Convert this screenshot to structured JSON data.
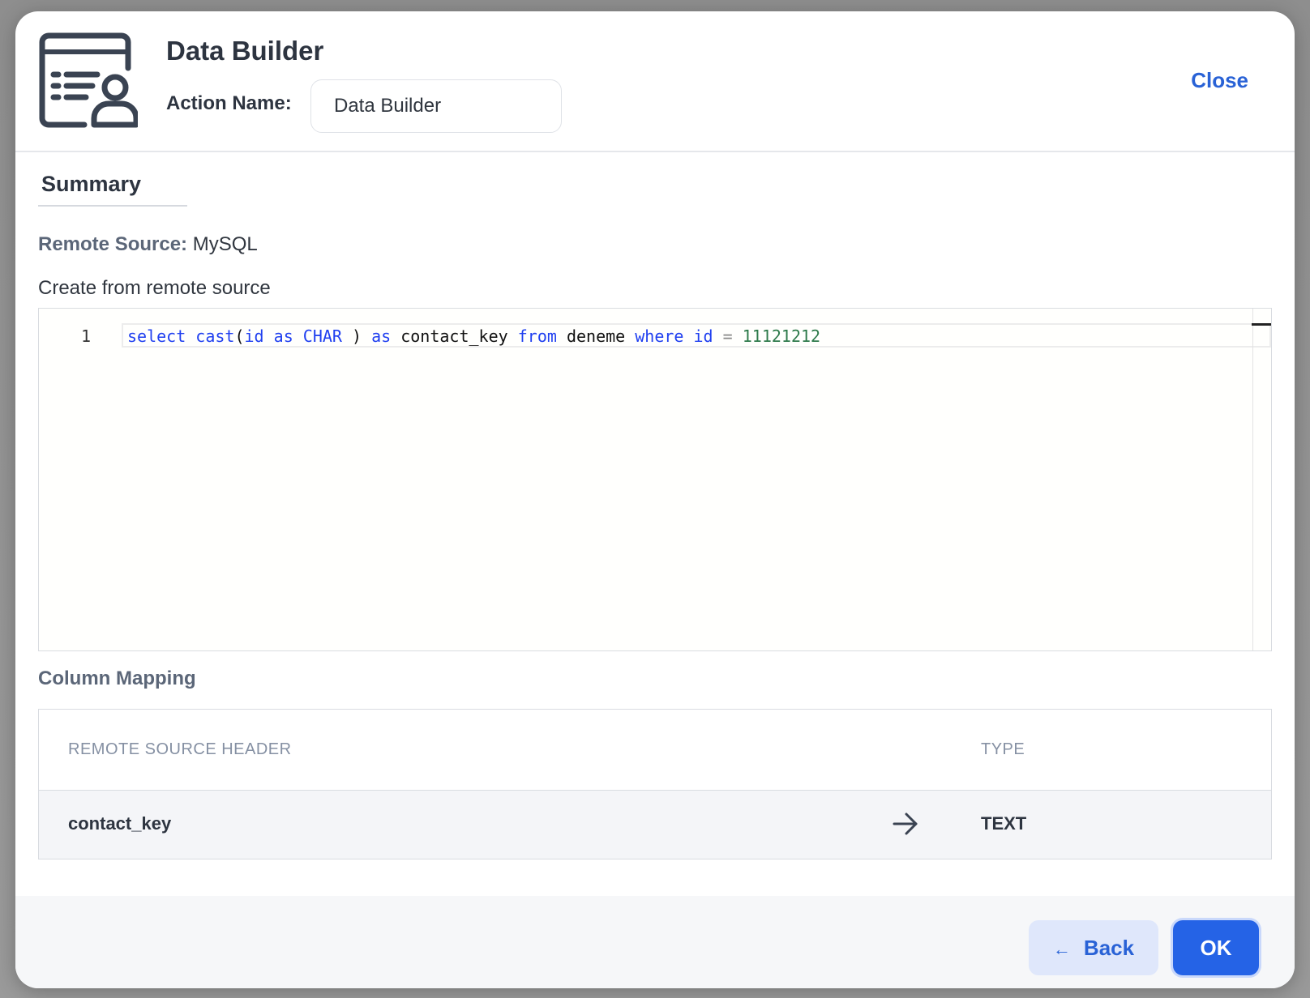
{
  "header": {
    "title": "Data Builder",
    "action_name_label": "Action Name:",
    "action_name_value": "Data Builder",
    "close_label": "Close",
    "icon": "data-builder-icon"
  },
  "summary": {
    "tab_label": "Summary",
    "remote_source_label": "Remote Source:",
    "remote_source_value": "MySQL",
    "create_label": "Create from remote source"
  },
  "editor": {
    "line_number": "1",
    "tokens": {
      "t1": "select",
      "t2": "cast",
      "t3": "(",
      "t4": "id",
      "t5": "as",
      "t6": "CHAR",
      "t7": " ) ",
      "t8": "as",
      "t9": " contact_key ",
      "t10": "from",
      "t11": " deneme ",
      "t12": "where",
      "t13": "id",
      "t14": "=",
      "t15": "11121212"
    }
  },
  "column_mapping": {
    "title": "Column Mapping",
    "headers": {
      "source": "REMOTE SOURCE HEADER",
      "type": "TYPE"
    },
    "rows": [
      {
        "source": "contact_key",
        "type": "TEXT"
      }
    ]
  },
  "footer": {
    "back_label": "Back",
    "back_arrow": "←",
    "ok_label": "OK"
  },
  "colors": {
    "accent": "#2563e6",
    "link": "#2962d6",
    "keyword": "#1f3ff0",
    "number": "#2d7a4a"
  }
}
